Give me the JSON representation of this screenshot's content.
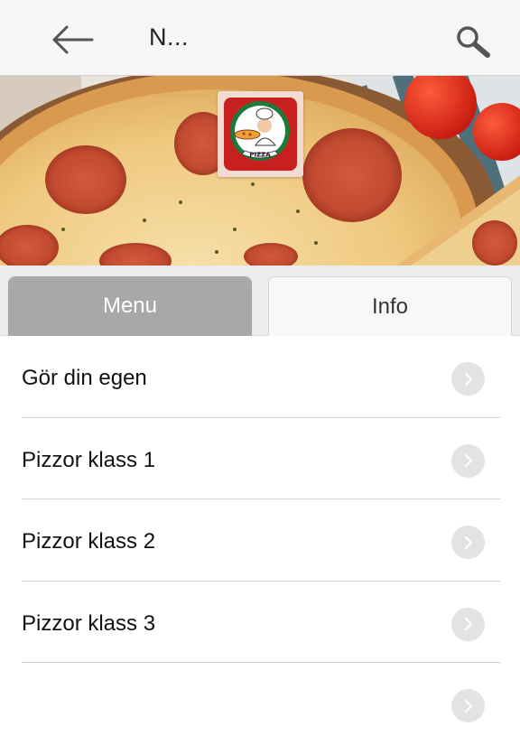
{
  "header": {
    "title": "N...",
    "back_icon": "arrow-left-icon",
    "search_icon": "magnifier-icon"
  },
  "hero": {
    "logo_text": "PIZZA"
  },
  "tabs": [
    {
      "label": "Menu",
      "active": true
    },
    {
      "label": "Info",
      "active": false
    }
  ],
  "menu_items": [
    {
      "label": "Gör din egen"
    },
    {
      "label": "Pizzor klass 1"
    },
    {
      "label": "Pizzor klass 2"
    },
    {
      "label": "Pizzor klass 3"
    }
  ],
  "colors": {
    "active_tab": "#a8a8a8",
    "header_bg": "#f6f6f6",
    "chevron_bg": "#e3e3e3"
  }
}
